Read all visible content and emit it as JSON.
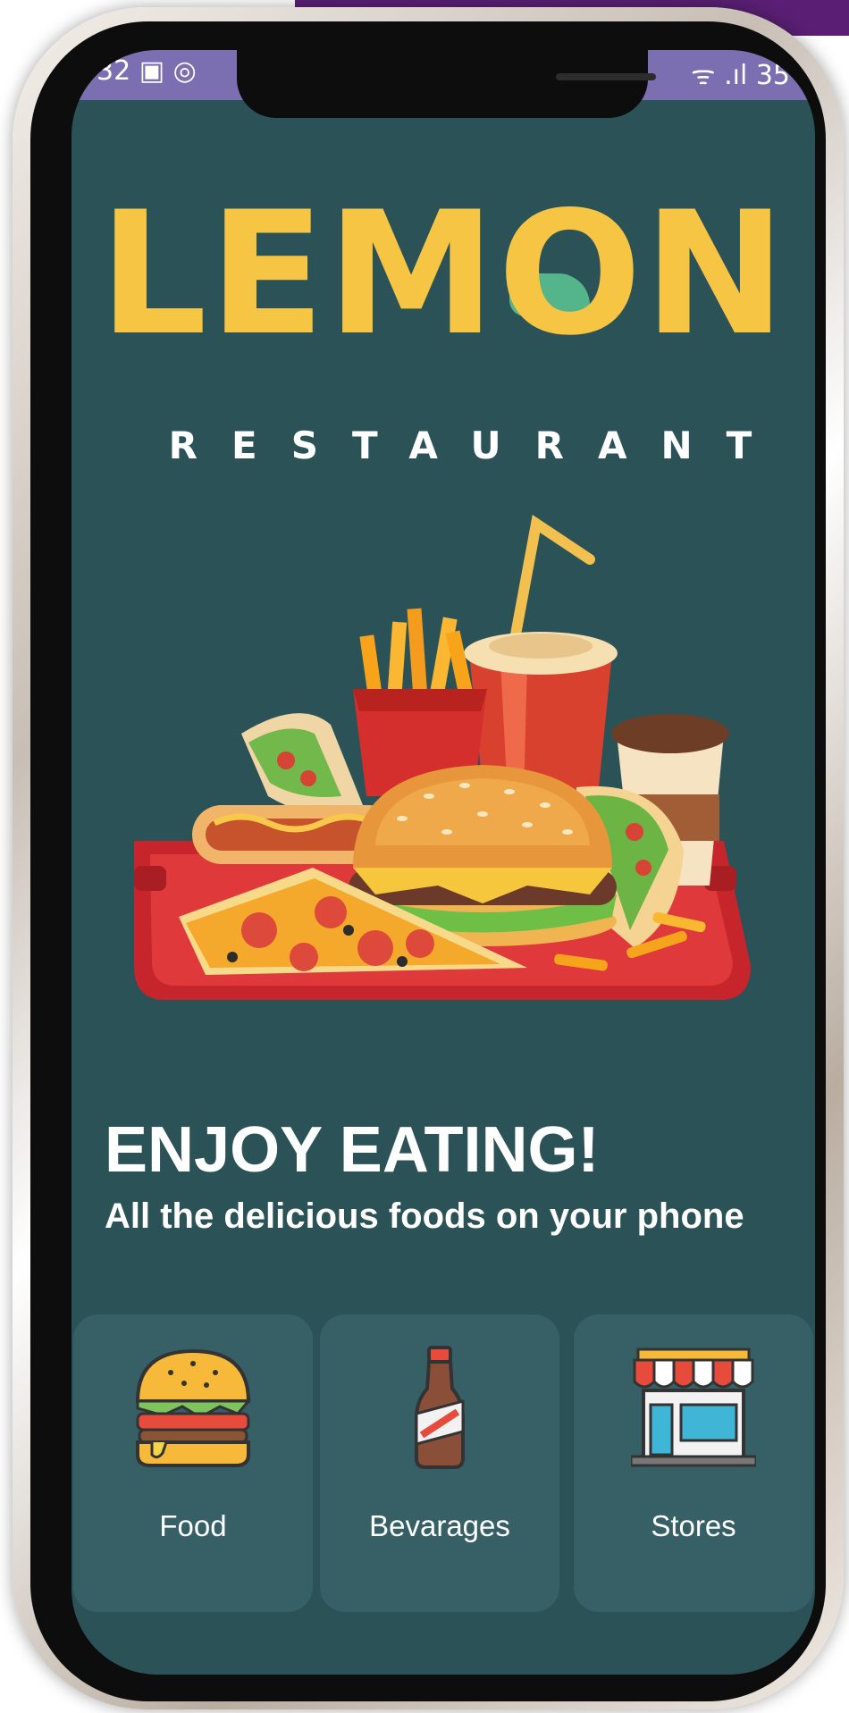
{
  "status_bar": {
    "left": "32 ▣ ◎",
    "right": "ᯤ .ıl 35"
  },
  "logo": {
    "name": "LEMON",
    "subtitle": "RESTAURANT"
  },
  "hero": {
    "headline": "ENJOY EATING!",
    "subline": "All the delicious foods on your phone"
  },
  "categories": [
    {
      "label": "Food",
      "icon": "burger-icon"
    },
    {
      "label": "Bevarages",
      "icon": "soda-bottle-icon"
    },
    {
      "label": "Stores",
      "icon": "storefront-icon"
    }
  ],
  "colors": {
    "background": "#2b5257",
    "card": "#376066",
    "accent": "#f6c544",
    "status_bar": "#7b6eb1"
  }
}
